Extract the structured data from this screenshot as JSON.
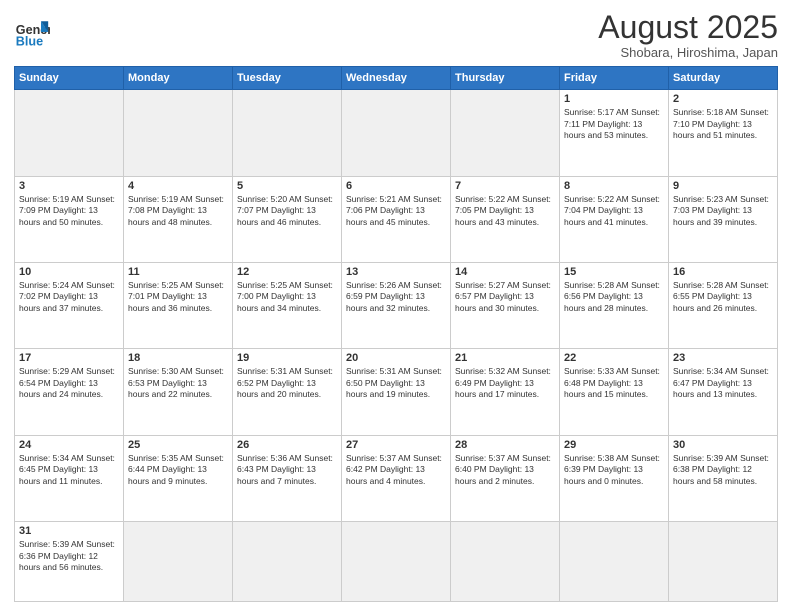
{
  "header": {
    "logo_general": "General",
    "logo_blue": "Blue",
    "month_title": "August 2025",
    "subtitle": "Shobara, Hiroshima, Japan"
  },
  "weekdays": [
    "Sunday",
    "Monday",
    "Tuesday",
    "Wednesday",
    "Thursday",
    "Friday",
    "Saturday"
  ],
  "weeks": [
    [
      {
        "day": "",
        "info": "",
        "empty": true
      },
      {
        "day": "",
        "info": "",
        "empty": true
      },
      {
        "day": "",
        "info": "",
        "empty": true
      },
      {
        "day": "",
        "info": "",
        "empty": true
      },
      {
        "day": "",
        "info": "",
        "empty": true
      },
      {
        "day": "1",
        "info": "Sunrise: 5:17 AM\nSunset: 7:11 PM\nDaylight: 13 hours\nand 53 minutes.",
        "empty": false
      },
      {
        "day": "2",
        "info": "Sunrise: 5:18 AM\nSunset: 7:10 PM\nDaylight: 13 hours\nand 51 minutes.",
        "empty": false
      }
    ],
    [
      {
        "day": "3",
        "info": "Sunrise: 5:19 AM\nSunset: 7:09 PM\nDaylight: 13 hours\nand 50 minutes.",
        "empty": false
      },
      {
        "day": "4",
        "info": "Sunrise: 5:19 AM\nSunset: 7:08 PM\nDaylight: 13 hours\nand 48 minutes.",
        "empty": false
      },
      {
        "day": "5",
        "info": "Sunrise: 5:20 AM\nSunset: 7:07 PM\nDaylight: 13 hours\nand 46 minutes.",
        "empty": false
      },
      {
        "day": "6",
        "info": "Sunrise: 5:21 AM\nSunset: 7:06 PM\nDaylight: 13 hours\nand 45 minutes.",
        "empty": false
      },
      {
        "day": "7",
        "info": "Sunrise: 5:22 AM\nSunset: 7:05 PM\nDaylight: 13 hours\nand 43 minutes.",
        "empty": false
      },
      {
        "day": "8",
        "info": "Sunrise: 5:22 AM\nSunset: 7:04 PM\nDaylight: 13 hours\nand 41 minutes.",
        "empty": false
      },
      {
        "day": "9",
        "info": "Sunrise: 5:23 AM\nSunset: 7:03 PM\nDaylight: 13 hours\nand 39 minutes.",
        "empty": false
      }
    ],
    [
      {
        "day": "10",
        "info": "Sunrise: 5:24 AM\nSunset: 7:02 PM\nDaylight: 13 hours\nand 37 minutes.",
        "empty": false
      },
      {
        "day": "11",
        "info": "Sunrise: 5:25 AM\nSunset: 7:01 PM\nDaylight: 13 hours\nand 36 minutes.",
        "empty": false
      },
      {
        "day": "12",
        "info": "Sunrise: 5:25 AM\nSunset: 7:00 PM\nDaylight: 13 hours\nand 34 minutes.",
        "empty": false
      },
      {
        "day": "13",
        "info": "Sunrise: 5:26 AM\nSunset: 6:59 PM\nDaylight: 13 hours\nand 32 minutes.",
        "empty": false
      },
      {
        "day": "14",
        "info": "Sunrise: 5:27 AM\nSunset: 6:57 PM\nDaylight: 13 hours\nand 30 minutes.",
        "empty": false
      },
      {
        "day": "15",
        "info": "Sunrise: 5:28 AM\nSunset: 6:56 PM\nDaylight: 13 hours\nand 28 minutes.",
        "empty": false
      },
      {
        "day": "16",
        "info": "Sunrise: 5:28 AM\nSunset: 6:55 PM\nDaylight: 13 hours\nand 26 minutes.",
        "empty": false
      }
    ],
    [
      {
        "day": "17",
        "info": "Sunrise: 5:29 AM\nSunset: 6:54 PM\nDaylight: 13 hours\nand 24 minutes.",
        "empty": false
      },
      {
        "day": "18",
        "info": "Sunrise: 5:30 AM\nSunset: 6:53 PM\nDaylight: 13 hours\nand 22 minutes.",
        "empty": false
      },
      {
        "day": "19",
        "info": "Sunrise: 5:31 AM\nSunset: 6:52 PM\nDaylight: 13 hours\nand 20 minutes.",
        "empty": false
      },
      {
        "day": "20",
        "info": "Sunrise: 5:31 AM\nSunset: 6:50 PM\nDaylight: 13 hours\nand 19 minutes.",
        "empty": false
      },
      {
        "day": "21",
        "info": "Sunrise: 5:32 AM\nSunset: 6:49 PM\nDaylight: 13 hours\nand 17 minutes.",
        "empty": false
      },
      {
        "day": "22",
        "info": "Sunrise: 5:33 AM\nSunset: 6:48 PM\nDaylight: 13 hours\nand 15 minutes.",
        "empty": false
      },
      {
        "day": "23",
        "info": "Sunrise: 5:34 AM\nSunset: 6:47 PM\nDaylight: 13 hours\nand 13 minutes.",
        "empty": false
      }
    ],
    [
      {
        "day": "24",
        "info": "Sunrise: 5:34 AM\nSunset: 6:45 PM\nDaylight: 13 hours\nand 11 minutes.",
        "empty": false
      },
      {
        "day": "25",
        "info": "Sunrise: 5:35 AM\nSunset: 6:44 PM\nDaylight: 13 hours\nand 9 minutes.",
        "empty": false
      },
      {
        "day": "26",
        "info": "Sunrise: 5:36 AM\nSunset: 6:43 PM\nDaylight: 13 hours\nand 7 minutes.",
        "empty": false
      },
      {
        "day": "27",
        "info": "Sunrise: 5:37 AM\nSunset: 6:42 PM\nDaylight: 13 hours\nand 4 minutes.",
        "empty": false
      },
      {
        "day": "28",
        "info": "Sunrise: 5:37 AM\nSunset: 6:40 PM\nDaylight: 13 hours\nand 2 minutes.",
        "empty": false
      },
      {
        "day": "29",
        "info": "Sunrise: 5:38 AM\nSunset: 6:39 PM\nDaylight: 13 hours\nand 0 minutes.",
        "empty": false
      },
      {
        "day": "30",
        "info": "Sunrise: 5:39 AM\nSunset: 6:38 PM\nDaylight: 12 hours\nand 58 minutes.",
        "empty": false
      }
    ],
    [
      {
        "day": "31",
        "info": "Sunrise: 5:39 AM\nSunset: 6:36 PM\nDaylight: 12 hours\nand 56 minutes.",
        "empty": false
      },
      {
        "day": "",
        "info": "",
        "empty": true
      },
      {
        "day": "",
        "info": "",
        "empty": true
      },
      {
        "day": "",
        "info": "",
        "empty": true
      },
      {
        "day": "",
        "info": "",
        "empty": true
      },
      {
        "day": "",
        "info": "",
        "empty": true
      },
      {
        "day": "",
        "info": "",
        "empty": true
      }
    ]
  ]
}
